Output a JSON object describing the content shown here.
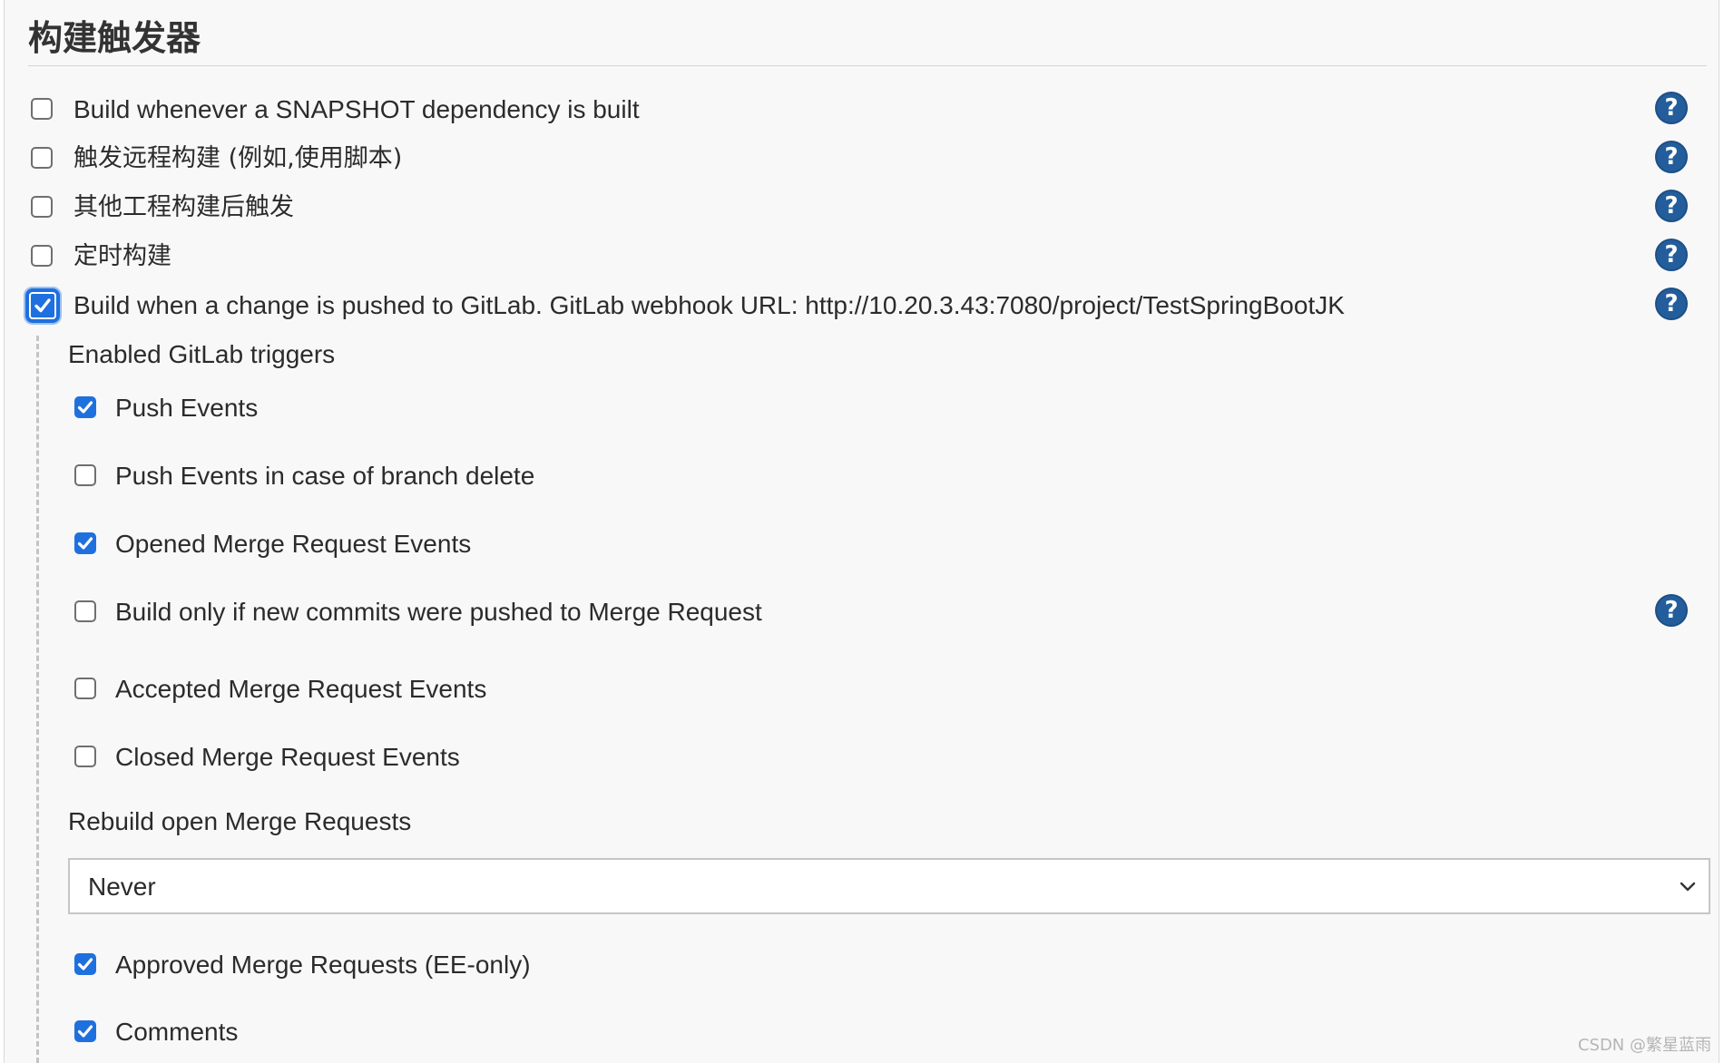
{
  "section": {
    "title": "构建触发器"
  },
  "triggers": [
    {
      "label": "Build whenever a SNAPSHOT dependency is built",
      "checked": false
    },
    {
      "label": "触发远程构建 (例如,使用脚本)",
      "checked": false
    },
    {
      "label": "其他工程构建后触发",
      "checked": false
    },
    {
      "label": "定时构建",
      "checked": false
    },
    {
      "label": "Build when a change is pushed to GitLab. GitLab webhook URL: http://10.20.3.43:7080/project/TestSpringBootJK",
      "checked": true
    }
  ],
  "gitlab": {
    "enabled_heading": "Enabled GitLab triggers",
    "options": [
      {
        "label": "Push Events",
        "checked": true
      },
      {
        "label": "Push Events in case of branch delete",
        "checked": false
      },
      {
        "label": "Opened Merge Request Events",
        "checked": true
      },
      {
        "label": "Build only if new commits were pushed to Merge Request",
        "checked": false
      },
      {
        "label": "Accepted Merge Request Events",
        "checked": false
      },
      {
        "label": "Closed Merge Request Events",
        "checked": false
      }
    ],
    "rebuild_heading": "Rebuild open Merge Requests",
    "rebuild_select": {
      "selected": "Never"
    },
    "more_options": [
      {
        "label": "Approved Merge Requests (EE-only)",
        "checked": true
      },
      {
        "label": "Comments",
        "checked": true
      }
    ]
  },
  "help_icon_glyph": "?",
  "watermark": "CSDN @繁星蓝雨",
  "colors": {
    "accent": "#1f70df",
    "help": "#245d9b",
    "background": "#f8f8f8"
  }
}
